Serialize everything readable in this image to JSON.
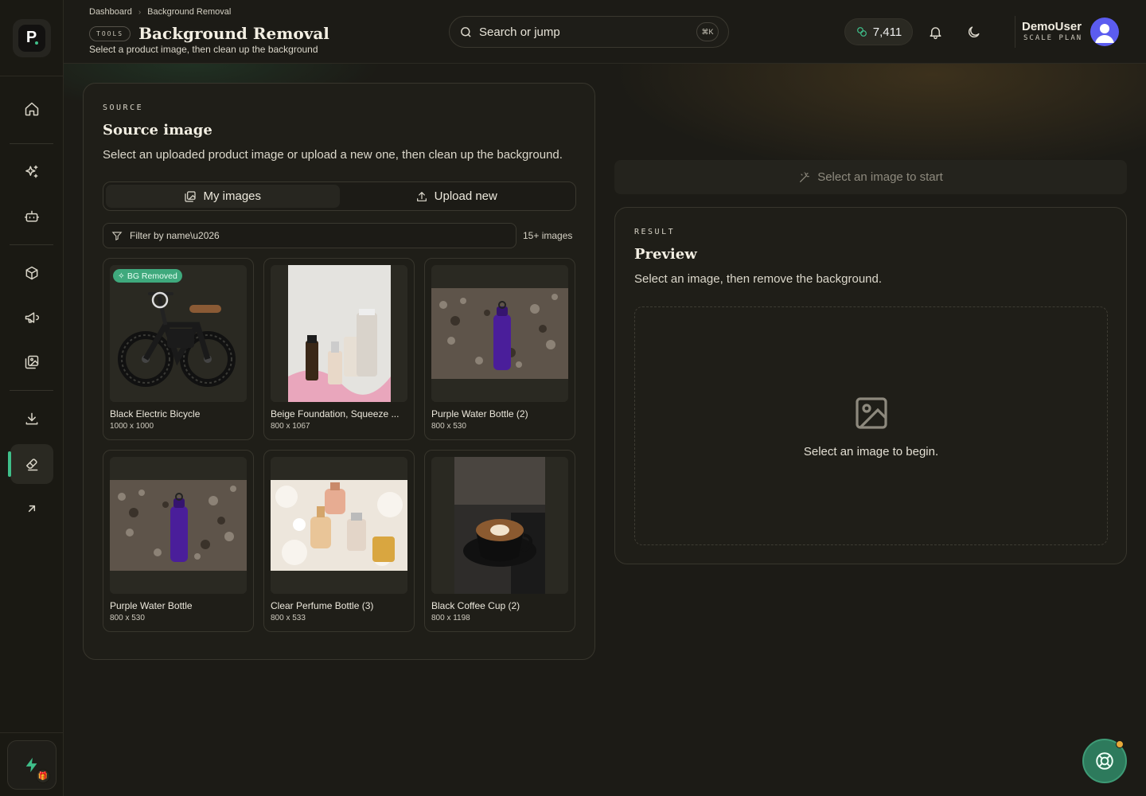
{
  "breadcrumb": {
    "home": "Dashboard",
    "current": "Background Removal"
  },
  "header": {
    "pill": "TOOLS",
    "title": "Background Removal",
    "subtitle": "Select a product image, then clean up the background",
    "search_placeholder": "Search or jump",
    "shortcut": "⌘K",
    "credits": "7,411",
    "user_name": "DemoUser",
    "user_plan": "SCALE PLAN"
  },
  "sidebar": {
    "items": [
      {
        "name": "home-icon"
      },
      {
        "name": "sparkles-icon"
      },
      {
        "name": "bot-icon"
      },
      {
        "name": "box-icon"
      },
      {
        "name": "megaphone-icon"
      },
      {
        "name": "images-icon"
      },
      {
        "name": "download-icon"
      },
      {
        "name": "eraser-icon",
        "active": true
      },
      {
        "name": "arrow-up-right-icon"
      }
    ]
  },
  "source": {
    "eyebrow": "SOURCE",
    "title": "Source image",
    "description": "Select an uploaded product image or upload a new one, then clean up the background.",
    "tab_my_images": "My images",
    "tab_upload": "Upload new",
    "filter_placeholder": "Filter by name\\u2026",
    "count": "15+ images",
    "images": [
      {
        "name": "Black Electric Bicycle",
        "dims": "1000 x 1000",
        "badge": "BG Removed"
      },
      {
        "name": "Beige Foundation, Squeeze ...",
        "dims": "800 x 1067"
      },
      {
        "name": "Purple Water Bottle (2)",
        "dims": "800 x 530"
      },
      {
        "name": "Purple Water Bottle",
        "dims": "800 x 530"
      },
      {
        "name": "Clear Perfume Bottle (3)",
        "dims": "800 x 533"
      },
      {
        "name": "Black Coffee Cup (2)",
        "dims": "800 x 1198"
      }
    ]
  },
  "start_hint": "Select an image to start",
  "result": {
    "eyebrow": "RESULT",
    "title": "Preview",
    "description": "Select an image, then remove the background.",
    "empty_message": "Select an image to begin."
  },
  "colors": {
    "accent": "#3fbf8a",
    "background": "#1c1b16",
    "card": "#1f1e18",
    "avatar": "#5b5cf0",
    "notification": "#e8a93a"
  }
}
